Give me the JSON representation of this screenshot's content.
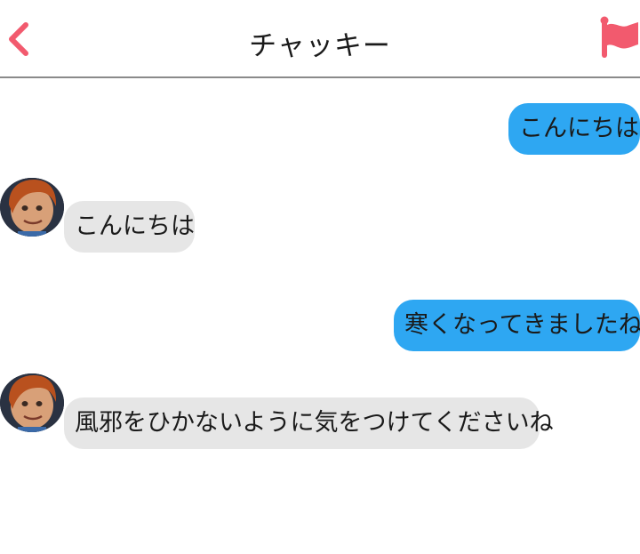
{
  "header": {
    "title": "チャッキー",
    "back_icon": "chevron-left-icon",
    "flag_icon": "flag-icon",
    "accent_color": "#f25a6e"
  },
  "colors": {
    "sent_bubble": "#2ea7f2",
    "received_bubble": "#e6e6e6",
    "divider": "#8a8a8a"
  },
  "messages": [
    {
      "from": "me",
      "text": "こんにちは"
    },
    {
      "from": "contact",
      "text": "こんにちは"
    },
    {
      "from": "me",
      "text": "寒くなってきましたね"
    },
    {
      "from": "contact",
      "text": "風邪をひかないように気をつけてくださいね"
    }
  ]
}
